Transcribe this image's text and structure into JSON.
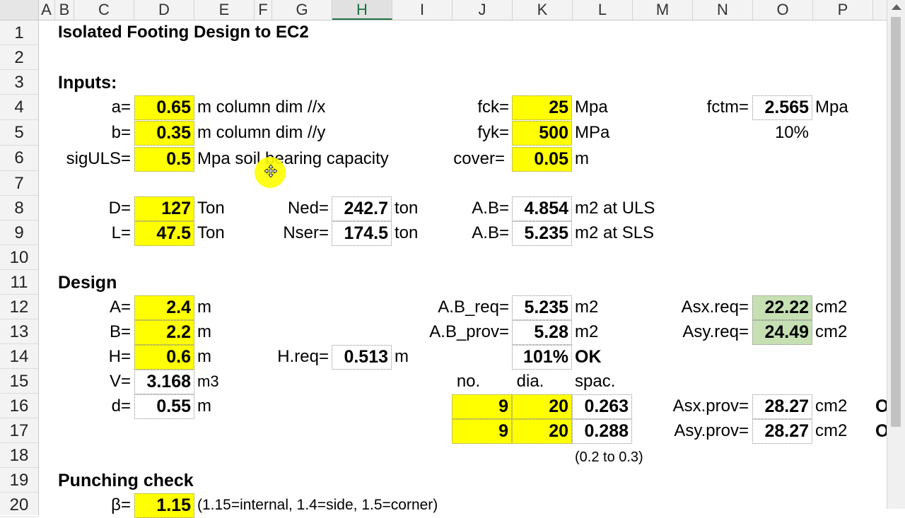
{
  "columns": [
    "A",
    "B",
    "C",
    "D",
    "E",
    "F",
    "G",
    "H",
    "I",
    "J",
    "K",
    "L",
    "M",
    "N",
    "O",
    "P"
  ],
  "rows": [
    "1",
    "2",
    "3",
    "4",
    "5",
    "6",
    "7",
    "8",
    "9",
    "10",
    "11",
    "12",
    "13",
    "14",
    "15",
    "16",
    "17",
    "18",
    "19",
    "20"
  ],
  "title": "Isolated Footing Design to EC2",
  "inputs_heading": "Inputs:",
  "inputs": {
    "a": {
      "label": "a=",
      "value": "0.65",
      "unit": "m column dim //x"
    },
    "b": {
      "label": "b=",
      "value": "0.35",
      "unit": "m column dim //y"
    },
    "sig": {
      "label": "sigULS=",
      "value": "0.5",
      "unit": "Mpa soil bearing capacity"
    },
    "D": {
      "label": "D=",
      "value": "127",
      "unit": "Ton"
    },
    "L": {
      "label": "L=",
      "value": "47.5",
      "unit": "Ton"
    },
    "Ned": {
      "label": "Ned=",
      "value": "242.7",
      "unit": "ton"
    },
    "Nser": {
      "label": "Nser=",
      "value": "174.5",
      "unit": "ton"
    },
    "fck": {
      "label": "fck=",
      "value": "25",
      "unit": "Mpa"
    },
    "fyk": {
      "label": "fyk=",
      "value": "500",
      "unit": "MPa"
    },
    "cover": {
      "label": "cover=",
      "value": "0.05",
      "unit": "m"
    },
    "AB_uls": {
      "label": "A.B=",
      "value": "4.854",
      "unit": "m2 at ULS"
    },
    "AB_sls": {
      "label": "A.B=",
      "value": "5.235",
      "unit": "m2 at SLS"
    },
    "fctm": {
      "label": "fctm=",
      "value": "2.565",
      "unit": "Mpa"
    },
    "pct": "10%"
  },
  "design_heading": "Design",
  "design": {
    "A": {
      "label": "A=",
      "value": "2.4",
      "unit": "m"
    },
    "B": {
      "label": "B=",
      "value": "2.2",
      "unit": "m"
    },
    "H": {
      "label": "H=",
      "value": "0.6",
      "unit": "m"
    },
    "V": {
      "label": "V=",
      "value": "3.168",
      "unit": "m3"
    },
    "d": {
      "label": "d=",
      "value": "0.55",
      "unit": "m"
    },
    "Hreq": {
      "label": "H.req=",
      "value": "0.513",
      "unit": "m"
    },
    "ABreq": {
      "label": "A.B_req=",
      "value": "5.235",
      "unit": "m2"
    },
    "ABprov": {
      "label": "A.B_prov=",
      "value": "5.28",
      "unit": "m2"
    },
    "ratio": {
      "value": "101%",
      "status": "OK"
    },
    "bar_headers": {
      "no": "no.",
      "dia": "dia.",
      "spac": "spac."
    },
    "bars": [
      {
        "no": "9",
        "dia": "20",
        "spac": "0.263"
      },
      {
        "no": "9",
        "dia": "20",
        "spac": "0.288"
      }
    ],
    "spac_note": "(0.2 to 0.3)",
    "Asx_req": {
      "label": "Asx.req=",
      "value": "22.22",
      "unit": "cm2"
    },
    "Asy_req": {
      "label": "Asy.req=",
      "value": "24.49",
      "unit": "cm2"
    },
    "Asx_prov": {
      "label": "Asx.prov=",
      "value": "28.27",
      "unit": "cm2",
      "flag": "O"
    },
    "Asy_prov": {
      "label": "Asy.prov=",
      "value": "28.27",
      "unit": "cm2",
      "flag": "O"
    }
  },
  "punching_heading": "Punching check",
  "punching": {
    "label": "β=",
    "value": "1.15",
    "note": "(1.15=internal, 1.4=side, 1.5=corner)"
  },
  "colors": {
    "input_yellow": "#ffff00",
    "result_green": "#c6e0b4",
    "header_active": "#217346"
  }
}
